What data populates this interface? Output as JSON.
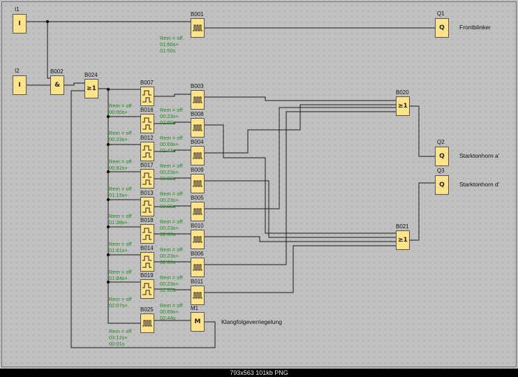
{
  "status_text": "793x563 101kb PNG",
  "blocks": [
    {
      "name": "I1",
      "symbol": "I",
      "kind": "text"
    },
    {
      "name": "I2",
      "symbol": "I",
      "kind": "text"
    },
    {
      "name": "B002",
      "symbol": "&",
      "kind": "text"
    },
    {
      "name": "B024",
      "symbol": "≥1",
      "kind": "text"
    },
    {
      "name": "B001",
      "symbol": "",
      "kind": "pulse"
    },
    {
      "name": "Q1",
      "symbol": "Q",
      "kind": "text"
    },
    {
      "name": "B007",
      "symbol": "",
      "kind": "timer"
    },
    {
      "name": "B016",
      "symbol": "",
      "kind": "timer"
    },
    {
      "name": "B012",
      "symbol": "",
      "kind": "timer"
    },
    {
      "name": "B017",
      "symbol": "",
      "kind": "timer"
    },
    {
      "name": "B013",
      "symbol": "",
      "kind": "timer"
    },
    {
      "name": "B018",
      "symbol": "",
      "kind": "timer"
    },
    {
      "name": "B014",
      "symbol": "",
      "kind": "timer"
    },
    {
      "name": "B019",
      "symbol": "",
      "kind": "timer"
    },
    {
      "name": "B025",
      "symbol": "",
      "kind": "pulse"
    },
    {
      "name": "B003",
      "symbol": "",
      "kind": "pulse"
    },
    {
      "name": "B008",
      "symbol": "",
      "kind": "pulse"
    },
    {
      "name": "B004",
      "symbol": "",
      "kind": "pulse"
    },
    {
      "name": "B009",
      "symbol": "",
      "kind": "pulse"
    },
    {
      "name": "B005",
      "symbol": "",
      "kind": "pulse"
    },
    {
      "name": "B010",
      "symbol": "",
      "kind": "pulse"
    },
    {
      "name": "B006",
      "symbol": "",
      "kind": "pulse"
    },
    {
      "name": "B011",
      "symbol": "",
      "kind": "pulse"
    },
    {
      "name": "M1",
      "symbol": "M",
      "kind": "text"
    },
    {
      "name": "B020",
      "symbol": "≥1",
      "kind": "text"
    },
    {
      "name": "B021",
      "symbol": "≥1",
      "kind": "text"
    },
    {
      "name": "Q2",
      "symbol": "Q",
      "kind": "text"
    },
    {
      "name": "Q3",
      "symbol": "Q",
      "kind": "text"
    }
  ],
  "output_labels": [
    "Frontblinker",
    "Starktonhorn a'",
    "Starktonhorn d'",
    "Klangfolgeverriegelung"
  ],
  "params": [
    [
      "Rem = off",
      "01:50s+",
      "01:50s"
    ],
    [
      "Rem = off",
      "00:00s+"
    ],
    [
      "Rem = off",
      "00:23s+"
    ],
    [
      "Rem = off",
      "00:92s+"
    ],
    [
      "Rem = off",
      "01:15s+"
    ],
    [
      "Rem = off",
      "01:38s+"
    ],
    [
      "Rem = off",
      "01:61s+"
    ],
    [
      "Rem = off",
      "01:84s+"
    ],
    [
      "Rem = off",
      "02:07s+"
    ],
    [
      "Rem = off",
      "03:12s+",
      "00:01s"
    ],
    [
      "Rem = off",
      "00:23s+",
      "02:90s"
    ],
    [
      "Rem = off",
      "00:69s+",
      "02:44s"
    ],
    [
      "Rem = off",
      "00:23s+",
      "02:90s"
    ],
    [
      "Rem = off",
      "00:23s+",
      "02:90s"
    ],
    [
      "Rem = off",
      "00:23s+",
      "02:90s"
    ],
    [
      "Rem = off",
      "00:23s+",
      "02:90s"
    ],
    [
      "Rem = off",
      "00:23s+",
      "02:90s"
    ],
    [
      "Rem = off",
      "00:69s+",
      "02:44s"
    ]
  ]
}
